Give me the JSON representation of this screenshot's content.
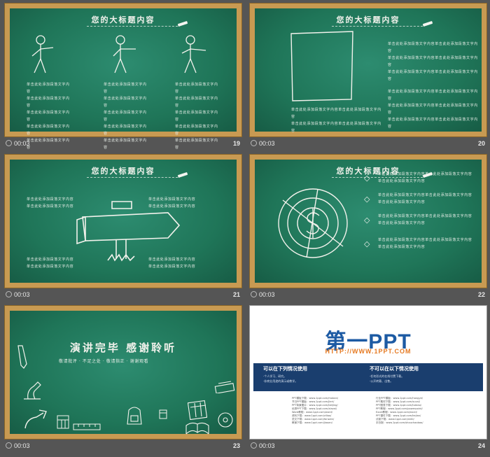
{
  "slides": [
    {
      "time": "00:03",
      "number": "19",
      "title": "您的大标题内容",
      "text": [
        "单击此处添加段落文字内容",
        "单击此处添加段落文字内容",
        "单击此处添加段落文字内容"
      ]
    },
    {
      "time": "00:03",
      "number": "20",
      "title": "您的大标题内容",
      "text": [
        "单击此处添加段落文字内容单击此处添加段落文字内容",
        "单击此处添加段落文字内容单击此处添加段落文字内容"
      ]
    },
    {
      "time": "00:03",
      "number": "21",
      "title": "您的大标题内容",
      "text": [
        "单击此处添加段落文字内容",
        "单击此处添加段落文字内容"
      ]
    },
    {
      "time": "00:03",
      "number": "22",
      "title": "您的大标题内容",
      "text": [
        "单击此处添加段落文字内容单击此处添加段落文字内容",
        "单击此处添加段落文字内容"
      ]
    },
    {
      "time": "00:03",
      "number": "23",
      "title": "演讲完毕 感谢聆听",
      "subtitle": "敬请批评 · 不足之处 · 敬请指正 · 谢谢观看"
    },
    {
      "time": "00:03",
      "number": "24",
      "logo": "第一PPT",
      "url": "HTTP://WWW.1PPT.COM",
      "can_use": "可以在下列情况使用",
      "cannot_use": "不可以在以下情况使用",
      "can_items": [
        "个人学习、研究。",
        "非商业用途的演示或教学。"
      ],
      "cannot_items": [
        "任何形式的在线付费下载。",
        "公开转载、出售。"
      ],
      "links_left": [
        "PPT模板下载：www.1ppt.com/moban/",
        "节日PPT模板：www.1ppt.com/jieri/",
        "PPT背景图片：www.1ppt.com/beijing/",
        "优秀PPT下载：www.1ppt.com/xiazai/",
        "Word教程：www.1ppt.com/word/",
        "资料下载：www.1ppt.com/ziliao/",
        "范文下载：www.1ppt.com/fanwen/",
        "教案下载：www.1ppt.com/jiaoan/"
      ],
      "links_right": [
        "行业PPT模板：www.1ppt.com/hangye/",
        "PPT素材下载：www.1ppt.com/sucai/",
        "PPT图表下载：www.1ppt.com/tubiao/",
        "PPT教程：www.1ppt.com/powerpoint/",
        "Excel教程：www.1ppt.com/excel/",
        "PPT课件下载：www.1ppt.com/kejian/",
        "试卷下载：www.1ppt.com/shiti/",
        "手抄报：www.1ppt.com/shouchaobao/"
      ]
    }
  ],
  "colors": {
    "board": "#1f7558",
    "frame": "#c89a52",
    "background": "#555555",
    "logo": "#1c5aa3",
    "url": "#e67a22",
    "band": "#1a3e6e"
  }
}
